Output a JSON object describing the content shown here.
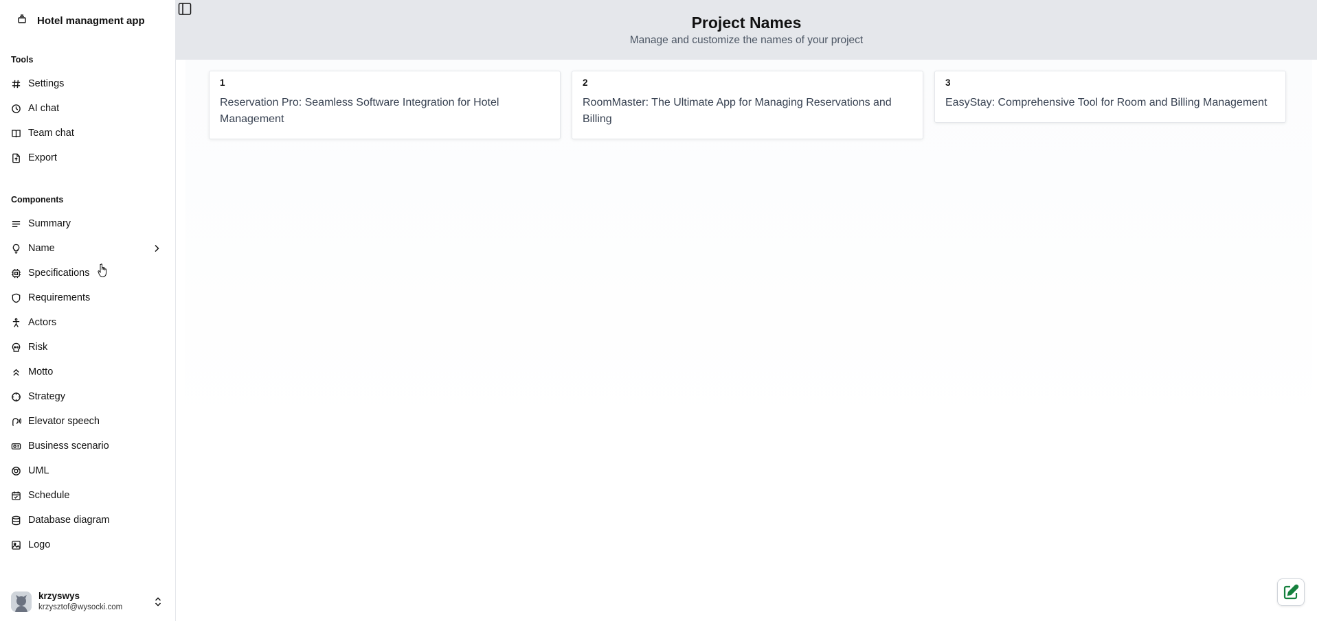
{
  "app": {
    "title": "Hotel managment app"
  },
  "sidebar": {
    "tools_title": "Tools",
    "tools": [
      {
        "label": "Settings",
        "icon": "hash-icon"
      },
      {
        "label": "AI chat",
        "icon": "clock-icon"
      },
      {
        "label": "Team chat",
        "icon": "book-icon"
      },
      {
        "label": "Export",
        "icon": "file-export-icon"
      }
    ],
    "components_title": "Components",
    "components": [
      {
        "label": "Summary",
        "icon": "lines-icon"
      },
      {
        "label": "Name",
        "icon": "lightbulb-icon"
      },
      {
        "label": "Specifications",
        "icon": "chip-icon"
      },
      {
        "label": "Requirements",
        "icon": "shield-icon"
      },
      {
        "label": "Actors",
        "icon": "person-icon"
      },
      {
        "label": "Risk",
        "icon": "skull-icon"
      },
      {
        "label": "Motto",
        "icon": "double-chevron-up-icon"
      },
      {
        "label": "Strategy",
        "icon": "crosshair-icon"
      },
      {
        "label": "Elevator speech",
        "icon": "speech-icon"
      },
      {
        "label": "Business scenario",
        "icon": "projector-icon"
      },
      {
        "label": "UML",
        "icon": "uml-icon"
      },
      {
        "label": "Schedule",
        "icon": "calendar-icon"
      },
      {
        "label": "Database diagram",
        "icon": "database-icon"
      },
      {
        "label": "Logo",
        "icon": "image-icon"
      }
    ]
  },
  "user": {
    "name": "krzyswys",
    "email": "krzysztof@wysocki.com"
  },
  "header": {
    "title": "Project Names",
    "subtitle": "Manage and customize the names of your project"
  },
  "cards": [
    {
      "number": "1",
      "text": "Reservation Pro: Seamless Software Integration for Hotel Management"
    },
    {
      "number": "2",
      "text": "RoomMaster: The Ultimate App for Managing Reservations and Billing"
    },
    {
      "number": "3",
      "text": "EasyStay: Comprehensive Tool for Room and Billing Management"
    }
  ],
  "colors": {
    "header_bg": "#e5e7eb",
    "fab_icon": "#15803d"
  }
}
